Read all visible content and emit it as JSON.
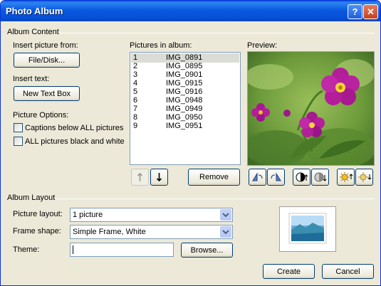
{
  "window": {
    "title": "Photo Album"
  },
  "album_content": {
    "group_label": "Album Content",
    "insert_picture_label": "Insert picture from:",
    "file_disk_button": "File/Disk...",
    "insert_text_label": "Insert text:",
    "new_text_box_button": "New Text Box",
    "picture_options_label": "Picture Options:",
    "captions_option": "Captions below ALL pictures",
    "captions_checked": false,
    "bw_option": "ALL pictures black and white",
    "bw_checked": false,
    "pictures_label": "Pictures in album:",
    "pictures": [
      {
        "num": "1",
        "name": "IMG_0891"
      },
      {
        "num": "2",
        "name": "IMG_0895"
      },
      {
        "num": "3",
        "name": "IMG_0901"
      },
      {
        "num": "4",
        "name": "IMG_0915"
      },
      {
        "num": "5",
        "name": "IMG_0916"
      },
      {
        "num": "6",
        "name": "IMG_0948"
      },
      {
        "num": "7",
        "name": "IMG_0949"
      },
      {
        "num": "8",
        "name": "IMG_0950"
      },
      {
        "num": "9",
        "name": "IMG_0951"
      }
    ],
    "selected_index": 0,
    "remove_button": "Remove",
    "preview_label": "Preview:"
  },
  "album_layout": {
    "group_label": "Album Layout",
    "picture_layout_label": "Picture layout:",
    "picture_layout_value": "1 picture",
    "frame_shape_label": "Frame shape:",
    "frame_shape_value": "Simple Frame, White",
    "theme_label": "Theme:",
    "theme_value": "",
    "browse_button": "Browse..."
  },
  "footer": {
    "create_button": "Create",
    "cancel_button": "Cancel"
  },
  "colors": {
    "title_bar": "#0a5fd8",
    "face": "#ece9d8",
    "selection": "#dcdcd7"
  }
}
